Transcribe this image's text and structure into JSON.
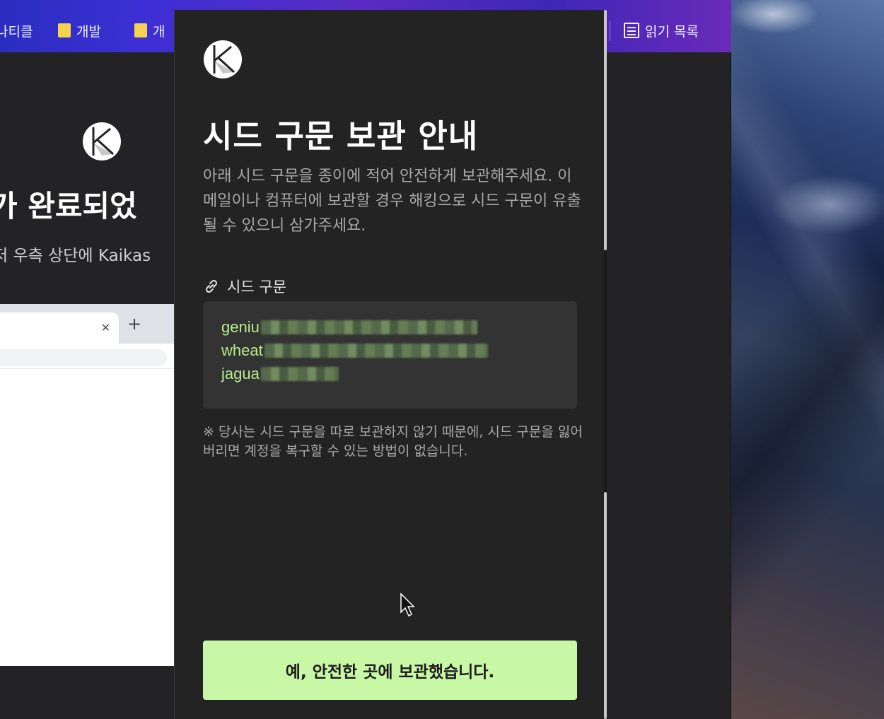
{
  "bookmarks": {
    "items": [
      {
        "label": "나티클"
      },
      {
        "label": "개발"
      },
      {
        "label": "개"
      }
    ],
    "reading_list": "읽기 목록"
  },
  "background_page": {
    "heading": "가 완료되었",
    "subtitle": "저 우측 상단에 Kaikas"
  },
  "icons": {
    "brand": "kaikas-logo-icon",
    "seed": "link-icon",
    "folder": "folder-icon",
    "reading_list": "reading-list-icon",
    "tab_close": "close-icon",
    "new_tab": "plus-icon",
    "pointer": "cursor-arrow-icon"
  },
  "popup": {
    "title": "시드 구문 보관 안내",
    "description": "아래 시드 구문을 종이에 적어 안전하게 보관해주세요. 이메일이나 컴퓨터에 보관할 경우 해킹으로 시드 구문이 유출될 수 있으니 삼가주세요.",
    "seed_label": "시드 구문",
    "seed_lines": [
      {
        "visible": "geniu"
      },
      {
        "visible": "wheat"
      },
      {
        "visible": "jagua"
      }
    ],
    "warning": "※ 당사는 시드 구문을 따로 보관하지 않기 때문에, 시드 구문을 잃어버리면 계정을 복구할 수 있는 방법이 없습니다.",
    "confirm_label": "예, 안전한 곳에 보관했습니다."
  },
  "colors": {
    "accent": "#c8f7a6",
    "seed_text": "#b5f08a",
    "popup_bg": "#232323"
  }
}
